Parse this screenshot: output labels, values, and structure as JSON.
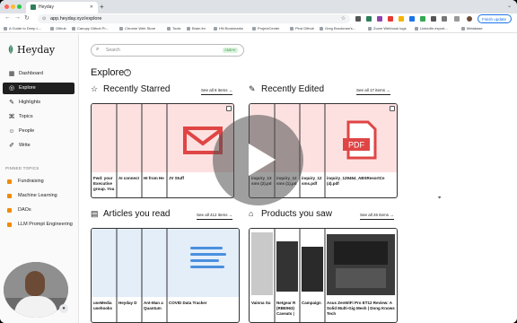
{
  "browser": {
    "tab_title": "Heyday",
    "url": "app.heyday.xyz/explore",
    "update_label": "Finish update",
    "bookmarks": [
      "A Guide to Deep L...",
      "Github",
      "Canopy Github Pr...",
      "Chrome Web Store",
      "Tools",
      "Brain.fm",
      "HN Bookmarks",
      "ProjectCenter",
      "Pind Github",
      "Greg Brockman's...",
      "Zoom Webhook logs",
      "LinkedIn export...",
      "Metabase"
    ]
  },
  "sidebar": {
    "app_name": "Heyday",
    "nav": [
      {
        "label": "Dashboard",
        "icon": "dashboard-icon"
      },
      {
        "label": "Explore",
        "icon": "compass-icon",
        "active": true
      },
      {
        "label": "Highlights",
        "icon": "highlighter-icon"
      },
      {
        "label": "Topics",
        "icon": "topics-icon"
      },
      {
        "label": "People",
        "icon": "person-icon"
      },
      {
        "label": "Write",
        "icon": "pen-icon"
      }
    ],
    "pinned_heading": "PINNED TOPICS",
    "pinned": [
      "Fundraising",
      "Machine Learning",
      "DAOs",
      "LLM Prompt Engineering"
    ]
  },
  "main": {
    "search_placeholder": "Search",
    "search_shortcut": "CMD+K",
    "page_title": "Explore",
    "help": "?",
    "sections": {
      "starred": {
        "title": "Recently Starred",
        "see_all": "See all 8 items →",
        "items": [
          "Fwd: your Executive group. You",
          "AI connect",
          "HI from He",
          "JV Stuff"
        ]
      },
      "edited": {
        "title": "Recently Edited",
        "see_all": "See all 17 items →",
        "items": [
          "inquiry_13 sms (2).pd",
          "inquiry_12 sms (1).pd",
          "inquiry_12 sms.pdf",
          "inquiry_129464_ABSResortCe (4).pdf"
        ]
      },
      "articles": {
        "title": "Articles you read",
        "see_all": "See all 412 items →",
        "items": [
          "useMedia usehooks",
          "Heyday D",
          "Ant-Man a Quantum",
          "COVID Data Tracker"
        ]
      },
      "products": {
        "title": "Products you saw",
        "see_all": "See all 26 items →",
        "items": [
          "Vainna Su",
          "Netgear R (RBE963) Caveats |",
          "Campaign",
          "Asus ZenWiFi Pro ET12 Review: A Solid Multi-Gig Mesh | Dong Knows Tech"
        ]
      }
    }
  },
  "colors": {
    "accent": "#1f1f1f",
    "email_red": "#e04545",
    "pdf_red": "#e04545",
    "doc_blue": "#4a8fdf"
  }
}
